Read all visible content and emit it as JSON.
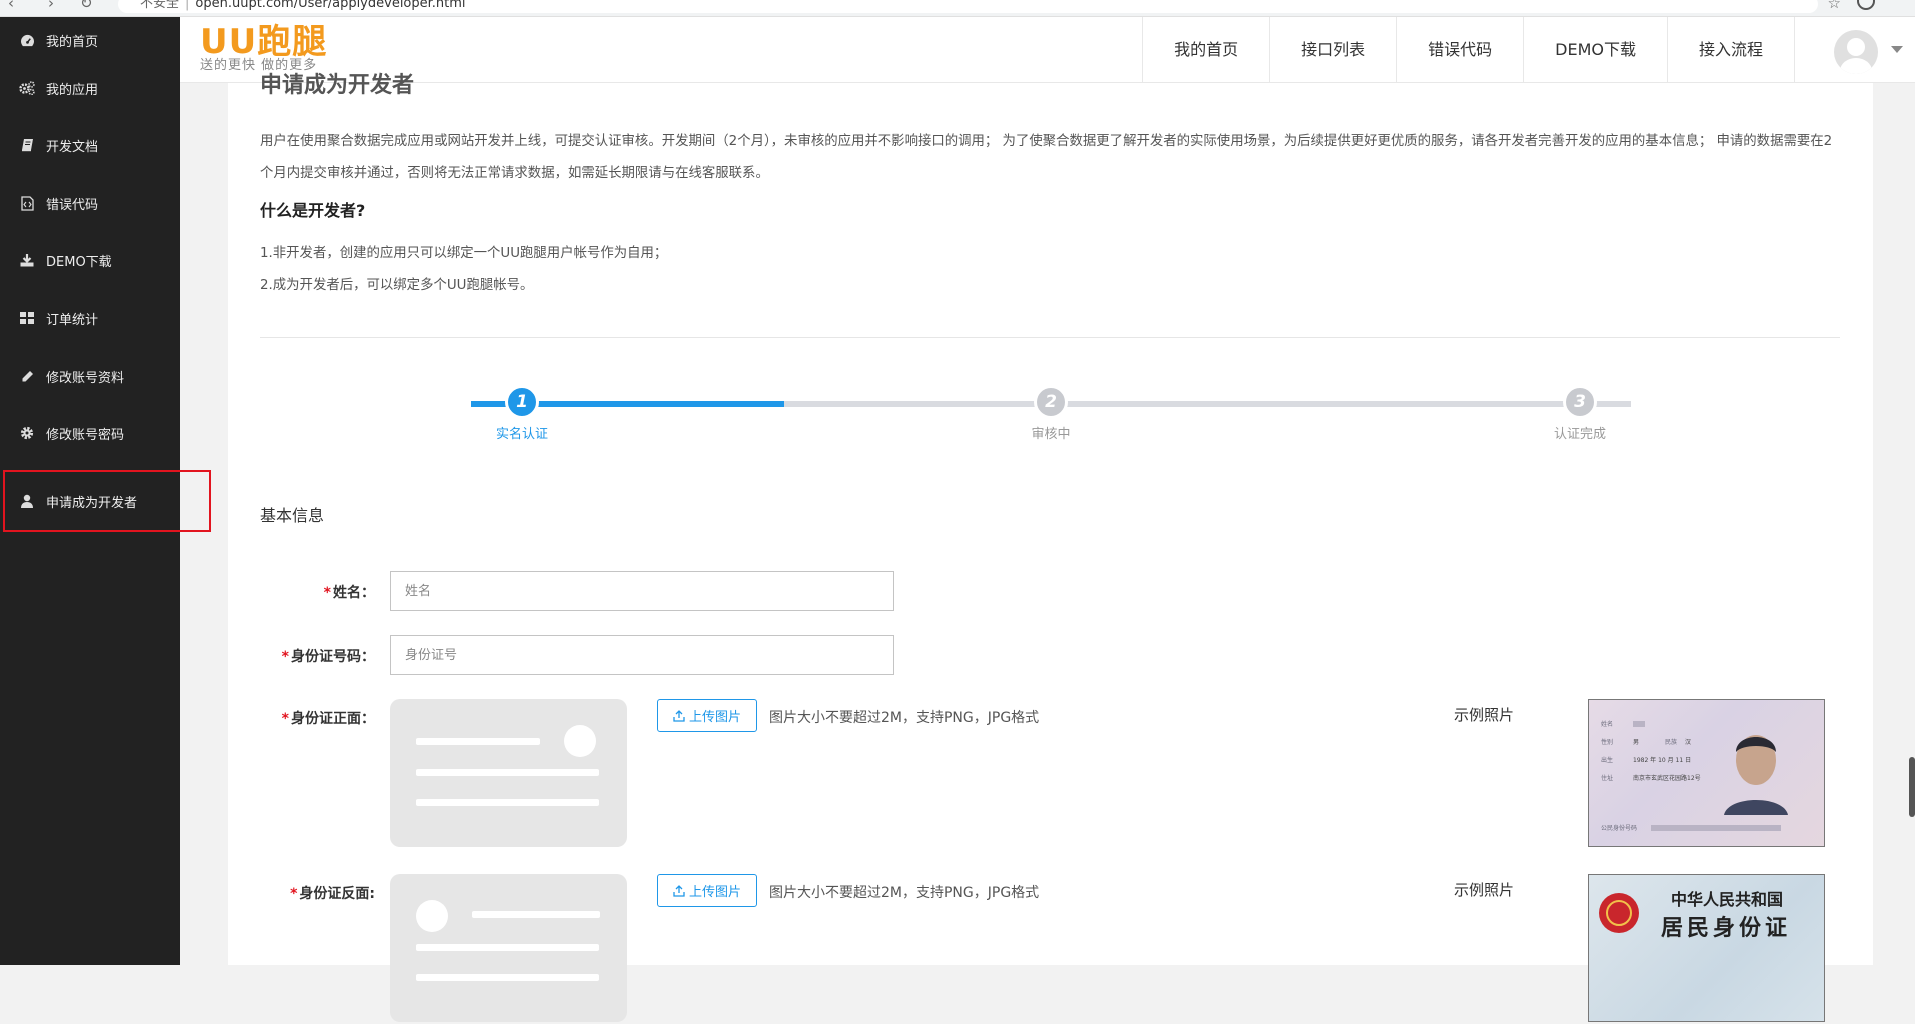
{
  "browser": {
    "security_label": "不安全",
    "url": "open.uupt.com/User/applydeveloper.html"
  },
  "sidebar": {
    "items": [
      {
        "label": "我的首页",
        "icon": "dashboard-icon"
      },
      {
        "label": "我的应用",
        "icon": "gears-icon"
      },
      {
        "label": "开发文档",
        "icon": "book-icon"
      },
      {
        "label": "错误代码",
        "icon": "file-code-icon"
      },
      {
        "label": "DEMO下载",
        "icon": "download-icon"
      },
      {
        "label": "订单统计",
        "icon": "grid-icon"
      },
      {
        "label": "修改账号资料",
        "icon": "pencil-icon"
      },
      {
        "label": "修改账号密码",
        "icon": "gear-icon"
      },
      {
        "label": "申请成为开发者",
        "icon": "user-icon"
      }
    ]
  },
  "header": {
    "logo_text": "UU跑腿",
    "slogan": "送的更快 做的更多",
    "nav": [
      "我的首页",
      "接口列表",
      "错误代码",
      "DEMO下载",
      "接入流程"
    ]
  },
  "page": {
    "title": "申请成为开发者",
    "intro": "用户在使用聚合数据完成应用或网站开发并上线，可提交认证审核。开发期间（2个月），未审核的应用并不影响接口的调用； 为了使聚合数据更了解开发者的实际使用场景，为后续提供更好更优质的服务，请各开发者完善开发的应用的基本信息； 申请的数据需要在2个月内提交审核并通过，否则将无法正常请求数据，如需延长期限请与在线客服联系。",
    "what_title": "什么是开发者?",
    "points": [
      "1.非开发者，创建的应用只可以绑定一个UU跑腿用户帐号作为自用；",
      "2.成为开发者后，可以绑定多个UU跑腿帐号。"
    ]
  },
  "steps": {
    "progress": 0.27,
    "items": [
      {
        "num": "1",
        "label": "实名认证",
        "active": true
      },
      {
        "num": "2",
        "label": "审核中",
        "active": false
      },
      {
        "num": "3",
        "label": "认证完成",
        "active": false
      }
    ]
  },
  "form": {
    "section_title": "基本信息",
    "required_mark": "*",
    "name_label": "姓名：",
    "name_placeholder": "姓名",
    "id_label": "身份证号码：",
    "id_placeholder": "身份证号",
    "front_label": "身份证正面：",
    "back_label": "身份证反面:",
    "upload_label": "上传图片",
    "upload_hint": "图片大小不要超过2M，支持PNG，JPG格式",
    "sample_label": "示例照片",
    "sample_front": {
      "name_key": "姓名",
      "sex_key": "性别",
      "sex_val": "男",
      "nation_key": "民族",
      "nation_val": "汉",
      "birth_key": "出生",
      "birth_val": "1982 年 10 月 11 日",
      "addr_key": "住址",
      "addr_val": "南京市玄武区花园路12号",
      "idno_key": "公民身份号码"
    },
    "sample_back": {
      "line1": "中华人民共和国",
      "line2": "居民身份证"
    }
  },
  "colors": {
    "accent": "#1f97e8",
    "required": "#e2141f",
    "sidebar_bg": "#222222",
    "logo_orange": "#f39a1e"
  }
}
